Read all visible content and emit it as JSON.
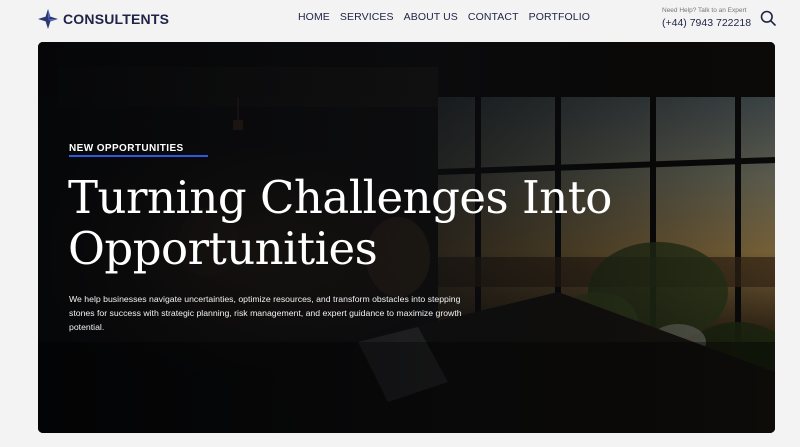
{
  "brand": {
    "name": "CONSULTENTS"
  },
  "nav": {
    "items": [
      {
        "label": "HOME"
      },
      {
        "label": "SERVICES"
      },
      {
        "label": "ABOUT US"
      },
      {
        "label": "CONTACT"
      },
      {
        "label": "PORTFOLIO"
      }
    ]
  },
  "contact": {
    "help_text": "Need Help? Talk to an Expert",
    "phone": "(+44) 7943 722218"
  },
  "icons": {
    "search": "search-icon",
    "logo": "four-point-star-icon"
  },
  "hero": {
    "eyebrow": "NEW OPPORTUNITIES",
    "headline": "Turning Challenges Into Opportunities",
    "description": "We help businesses navigate uncertainties, optimize resources, and transform obstacles into stepping stones for success with strategic planning, risk management, and expert guidance to maximize growth potential."
  },
  "colors": {
    "brand": "#1f2346",
    "accent": "#2f58e0",
    "page_bg": "#f3f3f3"
  }
}
